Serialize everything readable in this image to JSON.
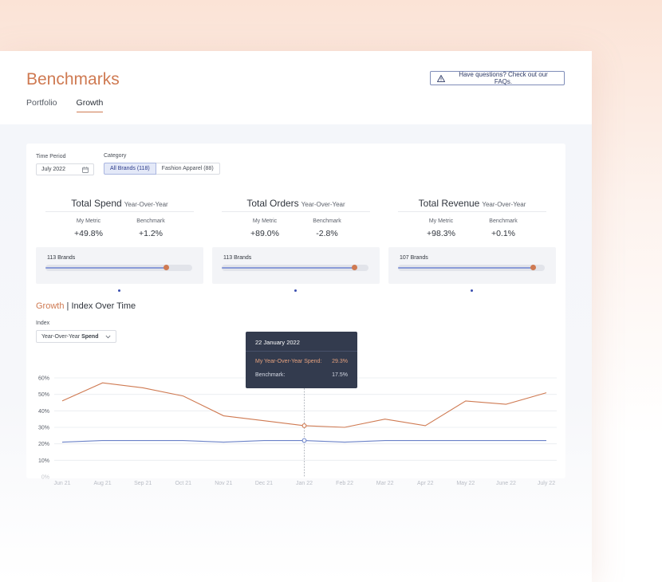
{
  "header": {
    "title": "Benchmarks",
    "tabs": [
      {
        "label": "Portfolio"
      },
      {
        "label": "Growth"
      }
    ],
    "faq_label": "Have questions? Check out our FAQs."
  },
  "filters": {
    "time_period_label": "Time Period",
    "time_period_value": "July 2022",
    "category_label": "Category",
    "categories": [
      "All Brands (118)",
      "Fashion Apparel (88)"
    ]
  },
  "kpis": [
    {
      "title": "Total Spend",
      "subtitle": "Year-Over-Year",
      "metric_label": "My Metric",
      "metric_value": "+49.8%",
      "benchmark_label": "Benchmark",
      "benchmark_value": "+1.2%",
      "brands": "113 Brands",
      "metric_pos": 0.82,
      "benchmark_pos": 0.5
    },
    {
      "title": "Total Orders",
      "subtitle": "Year-Over-Year",
      "metric_label": "My Metric",
      "metric_value": "+89.0%",
      "benchmark_label": "Benchmark",
      "benchmark_value": "-2.8%",
      "brands": "113 Brands",
      "metric_pos": 0.9,
      "benchmark_pos": 0.5
    },
    {
      "title": "Total Revenue",
      "subtitle": "Year-Over-Year",
      "metric_label": "My Metric",
      "metric_value": "+98.3%",
      "benchmark_label": "Benchmark",
      "benchmark_value": "+0.1%",
      "brands": "107 Brands",
      "metric_pos": 0.92,
      "benchmark_pos": 0.5
    }
  ],
  "growth": {
    "title_accent": "Growth",
    "title_rest": "Index Over Time",
    "index_label": "Index",
    "index_select_prefix": "Year-Over-Year",
    "index_select_bold": "Spend"
  },
  "tooltip": {
    "date": "22 January 2022",
    "row1_label": "My Year-Over-Year Spend:",
    "row1_value": "29.3%",
    "row2_label": "Benchmark:",
    "row2_value": "17.5%"
  },
  "colors": {
    "accent": "#cf7a52",
    "benchmark": "#6b82c8"
  },
  "chart_data": {
    "type": "line",
    "x": [
      "Jun 21",
      "Aug 21",
      "Sep 21",
      "Oct 21",
      "Nov 21",
      "Dec 21",
      "Jan 22",
      "Feb 22",
      "Mar 22",
      "Apr 22",
      "May 22",
      "June 22",
      "July 22"
    ],
    "series": [
      {
        "values": [
          46,
          57,
          54,
          49,
          37,
          34,
          31,
          30,
          35,
          31,
          46,
          44,
          51
        ]
      },
      {
        "values": [
          21,
          22,
          22,
          22,
          21,
          22,
          22,
          21,
          22,
          22,
          22,
          22,
          22
        ]
      }
    ],
    "y_ticks": [
      "60%",
      "50%",
      "40%",
      "30%",
      "20%",
      "10%",
      "0%"
    ],
    "ylim": [
      0,
      60
    ],
    "highlight_index": 6,
    "grid": true
  }
}
